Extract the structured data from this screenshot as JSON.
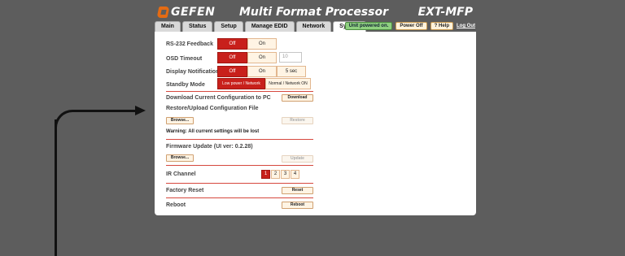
{
  "header": {
    "logo_text": "GEFEN",
    "app_title": "Multi Format Processor",
    "model": "EXT-MFP"
  },
  "tabs": [
    {
      "label": "Main",
      "active": false
    },
    {
      "label": "Status",
      "active": false
    },
    {
      "label": "Setup",
      "active": false
    },
    {
      "label": "Manage EDID",
      "active": false
    },
    {
      "label": "Network",
      "active": false
    },
    {
      "label": "System",
      "active": true
    }
  ],
  "status": {
    "power_state": "Unit powered on.",
    "power_button": "Power Off",
    "help_button": "? Help",
    "logout": "Log Out"
  },
  "system": {
    "rs232": {
      "label": "RS-232 Feedback",
      "options": [
        "Off",
        "On"
      ],
      "selected": "Off"
    },
    "osd_timeout": {
      "label": "OSD Timeout",
      "options": [
        "Off",
        "On"
      ],
      "selected": "Off",
      "value": "10"
    },
    "display_notification": {
      "label": "Display Notification",
      "options": [
        "Off",
        "On",
        "5 sec"
      ],
      "selected": "Off"
    },
    "standby_mode": {
      "label": "Standby Mode",
      "options": [
        "Low power / Network OFF",
        "Normal / Network ON"
      ],
      "selected": "Low power / Network OFF"
    },
    "download_config": {
      "label": "Download Current Configuration to PC",
      "button": "Download"
    },
    "restore_config": {
      "label": "Restore/Upload Configuration File",
      "browse_button": "Browse...",
      "restore_button": "Restore",
      "warning": "Warning: All current settings will be lost"
    },
    "firmware_update": {
      "label": "Firmware Update (UI ver: 0.2.28)",
      "browse_button": "Browse...",
      "update_button": "Update"
    },
    "ir_channel": {
      "label": "IR Channel",
      "options": [
        "1",
        "2",
        "3",
        "4"
      ],
      "selected": "1"
    },
    "factory_reset": {
      "label": "Factory Reset",
      "button": "Reset"
    },
    "reboot": {
      "label": "Reboot",
      "button": "Reboot"
    }
  },
  "colors": {
    "accent_red": "#c8201b",
    "button_bg": "#fff4e4",
    "status_green": "#8fd080",
    "background": "#5d5d5d"
  }
}
